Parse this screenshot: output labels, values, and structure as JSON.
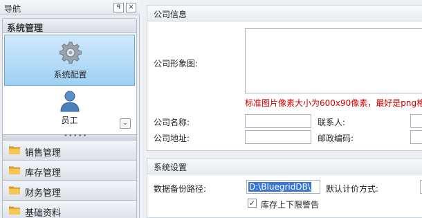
{
  "nav": {
    "title": "导航",
    "pin_glyph": "ꟼ",
    "close_glyph": "✕",
    "group_title": "系统管理",
    "items": [
      {
        "label": "系统配置",
        "icon": "gear-icon",
        "selected": true
      },
      {
        "label": "员工",
        "icon": "user-icon",
        "selected": false
      }
    ],
    "expand_glyph": "⌄",
    "splitter_dots": "•••••",
    "modules": [
      {
        "label": "销售管理",
        "icon": "folder-icon"
      },
      {
        "label": "库存管理",
        "icon": "folder-icon"
      },
      {
        "label": "财务管理",
        "icon": "folder-icon"
      },
      {
        "label": "基础资料",
        "icon": "folder-icon"
      }
    ]
  },
  "company": {
    "header": "公司信息",
    "image_label": "公司形象图:",
    "image_hint": "标准图片像素大小为600x90像素，最好是png格",
    "name_label": "公司名称:",
    "name_value": "",
    "contact_label": "联系人:",
    "contact_value": "",
    "address_label": "公司地址:",
    "address_value": "",
    "postcode_label": "邮政编码:",
    "postcode_value": ""
  },
  "system": {
    "header": "系统设置",
    "backup_label": "数据备份路径:",
    "backup_value": "D:\\BluegridDB\\",
    "pricing_label": "默认计价方式:",
    "pricing_value": "",
    "stock_alert_label": "库存上下限警告",
    "stock_alert_checked": true,
    "check_glyph": "✓"
  },
  "colors": {
    "selected_item": "#9fd0f3",
    "hint_text": "#d00000",
    "selection_highlight": "#3875d7"
  }
}
